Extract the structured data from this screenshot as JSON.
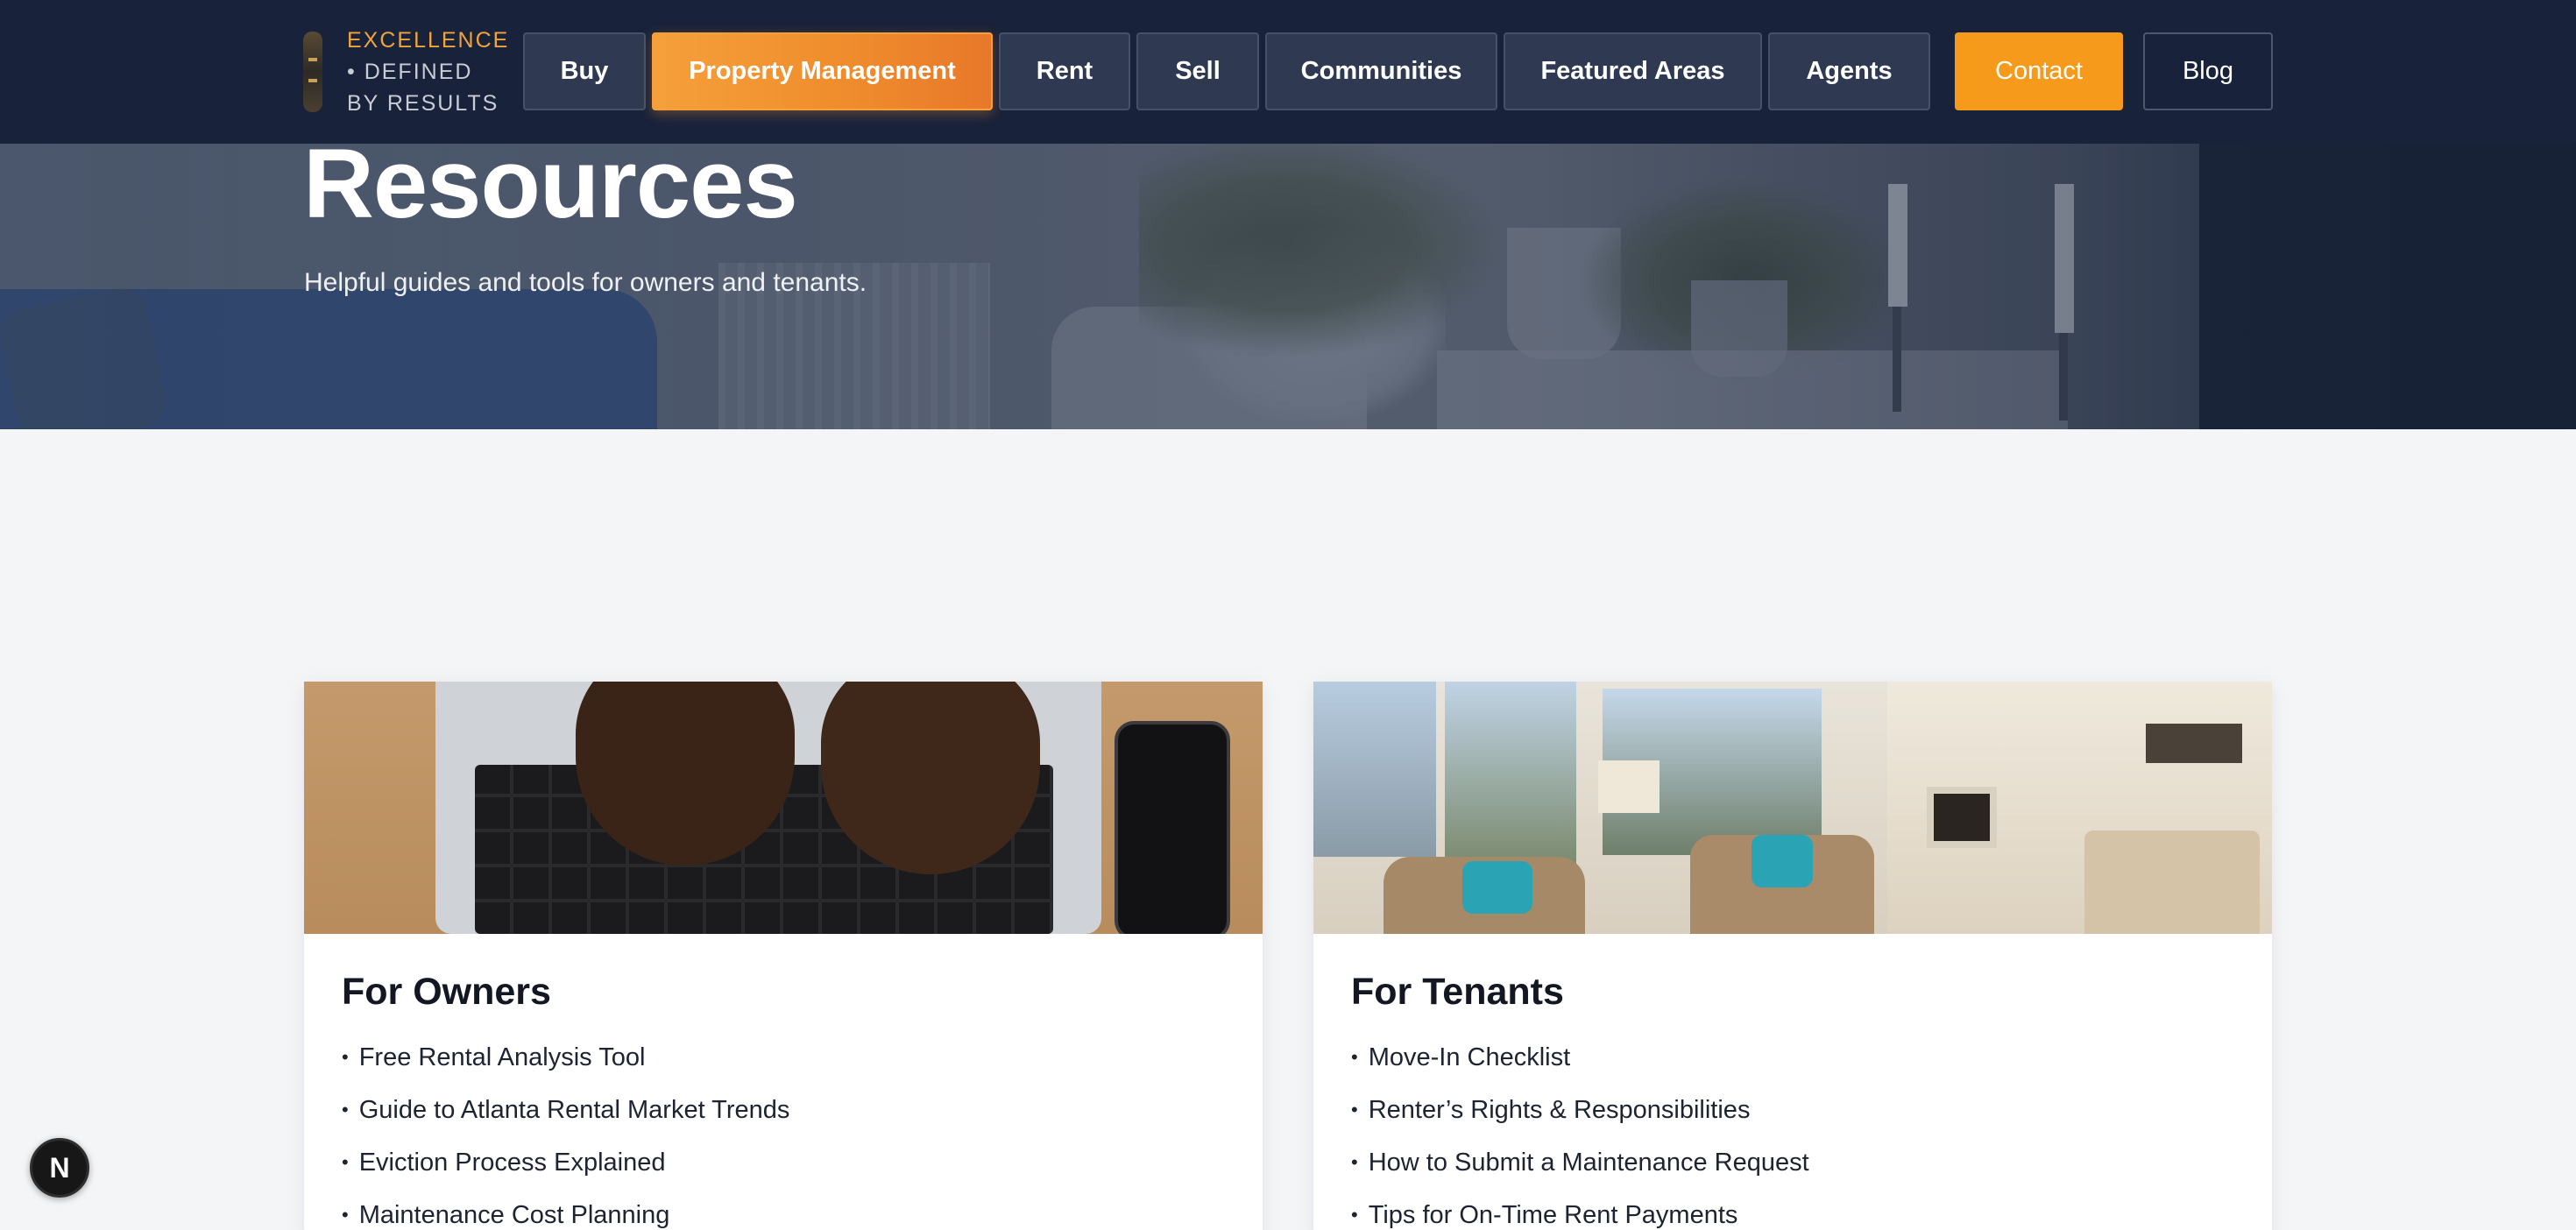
{
  "brand": {
    "tagline": [
      "EXCELLENCE",
      "• DEFINED",
      "BY RESULTS"
    ],
    "accent_color": "#f0a43a"
  },
  "nav": {
    "items": [
      {
        "label": "Buy",
        "active": false
      },
      {
        "label": "Property Management",
        "active": true
      },
      {
        "label": "Rent",
        "active": false
      },
      {
        "label": "Sell",
        "active": false
      },
      {
        "label": "Communities",
        "active": false
      },
      {
        "label": "Featured Areas",
        "active": false
      },
      {
        "label": "Agents",
        "active": false
      }
    ],
    "contact_label": "Contact",
    "blog_label": "Blog",
    "background_color": "#18223a",
    "active_color": "#f5a03a"
  },
  "hero": {
    "title": "Resources",
    "subtitle": "Helpful guides and tools for owners and tenants."
  },
  "cards": [
    {
      "title": "For Owners",
      "items": [
        "Free Rental Analysis Tool",
        "Guide to Atlanta Rental Market Trends",
        "Eviction Process Explained",
        "Maintenance Cost Planning"
      ]
    },
    {
      "title": "For Tenants",
      "items": [
        "Move-In Checklist",
        "Renter’s Rights & Responsibilities",
        "How to Submit a Maintenance Request",
        "Tips for On-Time Rent Payments"
      ]
    }
  ],
  "dev_badge": {
    "letter": "N",
    "icon": "nextjs-icon"
  }
}
